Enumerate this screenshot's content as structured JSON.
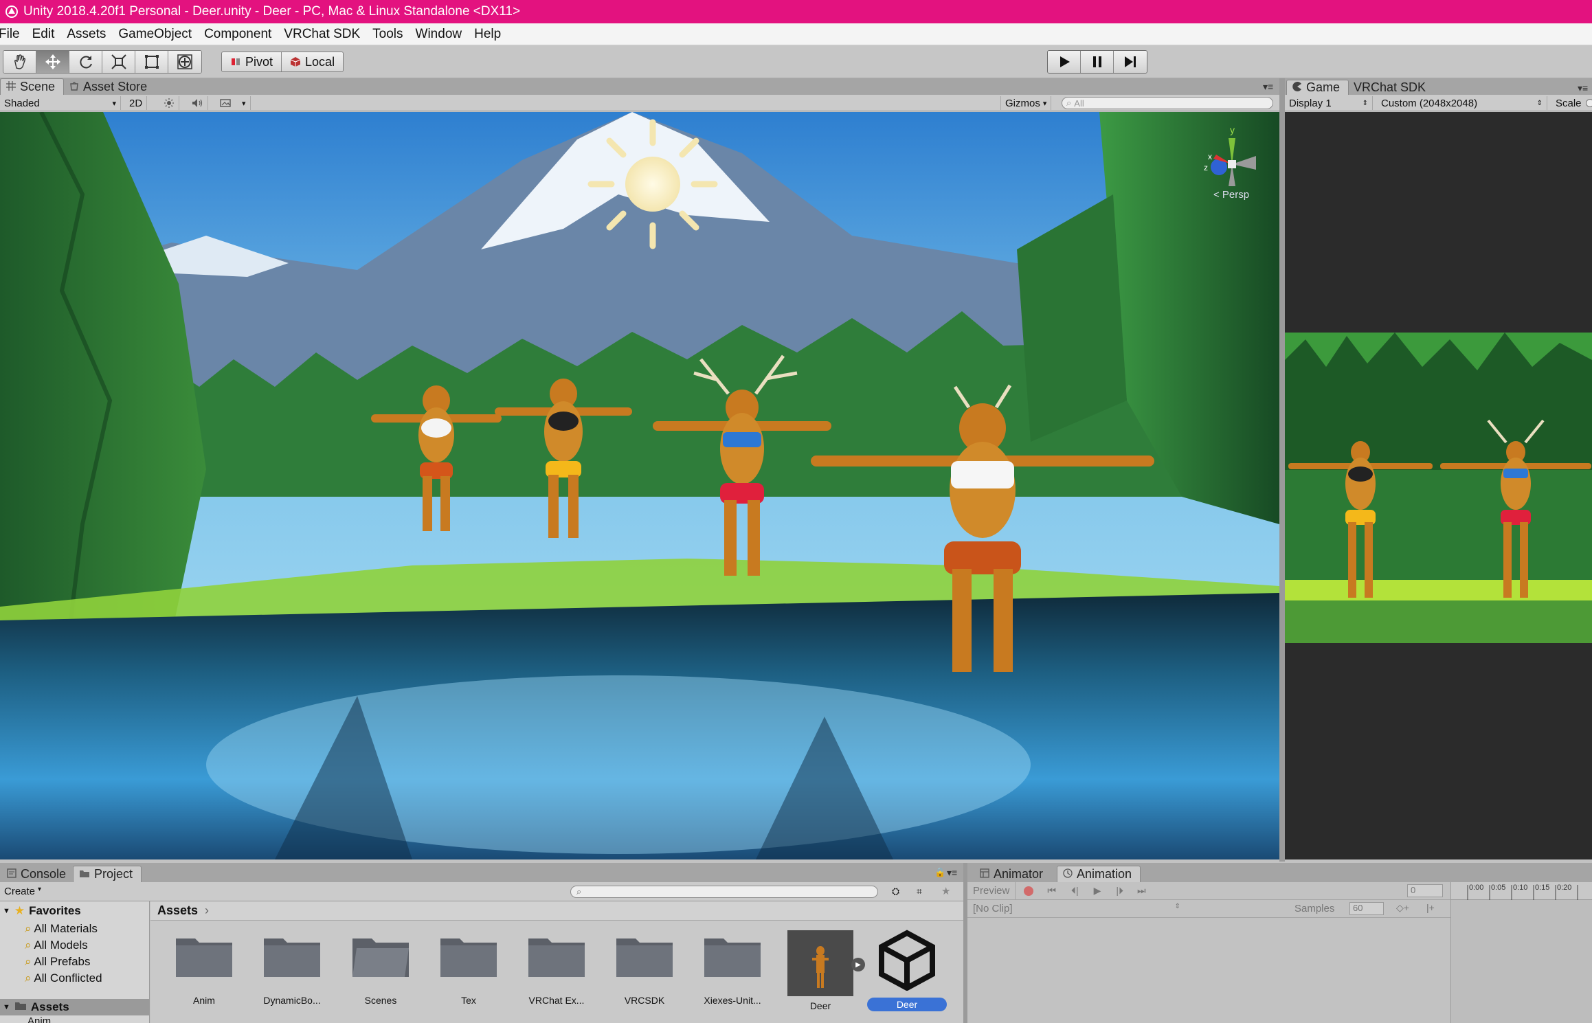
{
  "window": {
    "title": "Unity 2018.4.20f1 Personal - Deer.unity - Deer - PC, Mac & Linux Standalone <DX11>"
  },
  "menu": [
    "File",
    "Edit",
    "Assets",
    "GameObject",
    "Component",
    "VRChat SDK",
    "Tools",
    "Window",
    "Help"
  ],
  "toolbar": {
    "tools": [
      "hand-tool",
      "move-tool",
      "rotate-tool",
      "scale-tool",
      "rect-tool",
      "transform-tool"
    ],
    "pivot_label": "Pivot",
    "local_label": "Local",
    "playback": [
      "play",
      "pause",
      "step"
    ]
  },
  "scene": {
    "tabs": [
      "Scene",
      "Asset Store"
    ],
    "shading_mode": "Shaded",
    "mode_2d": "2D",
    "gizmos_label": "Gizmos",
    "search_placeholder": "All",
    "persp_label": "< Persp",
    "axes": {
      "y": "y",
      "x": "x",
      "z": "z"
    }
  },
  "game": {
    "tabs": [
      "Game",
      "VRChat SDK"
    ],
    "display": "Display 1",
    "resolution": "Custom (2048x2048)",
    "scale_label": "Scale"
  },
  "project": {
    "tabs": [
      "Console",
      "Project"
    ],
    "create_label": "Create",
    "favorites_label": "Favorites",
    "favorites": [
      "All Materials",
      "All Models",
      "All Prefabs",
      "All Conflicted"
    ],
    "assets_root_label": "Assets",
    "assets_child": "Anim",
    "breadcrumb": "Assets",
    "assets": [
      {
        "name": "Anim",
        "kind": "folder"
      },
      {
        "name": "DynamicBo...",
        "kind": "folder"
      },
      {
        "name": "Scenes",
        "kind": "folder-open"
      },
      {
        "name": "Tex",
        "kind": "folder"
      },
      {
        "name": "VRChat Ex...",
        "kind": "folder"
      },
      {
        "name": "VRCSDK",
        "kind": "folder"
      },
      {
        "name": "Xiexes-Unit...",
        "kind": "folder"
      },
      {
        "name": "Deer",
        "kind": "model"
      },
      {
        "name": "Deer",
        "kind": "unity-scene"
      }
    ]
  },
  "animation": {
    "tabs": [
      "Animator",
      "Animation"
    ],
    "preview_label": "Preview",
    "clip_label": "[No Clip]",
    "samples_label": "Samples",
    "samples_value": "60",
    "frame_value": "0",
    "ruler_labels": [
      "0:00",
      "0:05",
      "0:10",
      "0:15",
      "0:20"
    ]
  },
  "colors": {
    "titlebar": "#e3127f",
    "panel": "#c2c2c2",
    "selection": "#3a72d6"
  }
}
